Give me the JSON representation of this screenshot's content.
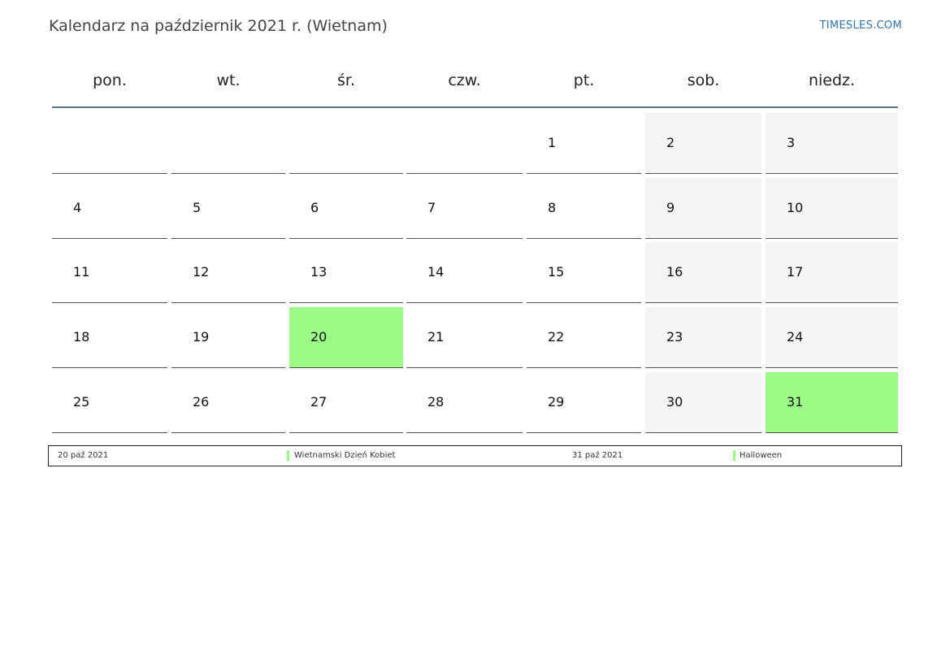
{
  "header": {
    "title": "Kalendarz na październik 2021 r. (Wietnam)",
    "brand": "TIMESLES.COM"
  },
  "weekdays": [
    "pon.",
    "wt.",
    "śr.",
    "czw.",
    "pt.",
    "sob.",
    "niedz."
  ],
  "weeks": [
    [
      "",
      "",
      "",
      "",
      "1",
      "2",
      "3"
    ],
    [
      "4",
      "5",
      "6",
      "7",
      "8",
      "9",
      "10"
    ],
    [
      "11",
      "12",
      "13",
      "14",
      "15",
      "16",
      "17"
    ],
    [
      "18",
      "19",
      "20",
      "21",
      "22",
      "23",
      "24"
    ],
    [
      "25",
      "26",
      "27",
      "28",
      "29",
      "30",
      "31"
    ]
  ],
  "holiday_days": [
    "20",
    "31"
  ],
  "legend": [
    {
      "date": "20 paź 2021",
      "name": "Wietnamski Dzień Kobiet"
    },
    {
      "date": "31 paź 2021",
      "name": "Halloween"
    }
  ],
  "colors": {
    "holiday": "#9afc86",
    "weekend": "#f4f4f4",
    "header_rule": "#5a7390",
    "brand": "#2e75b6"
  }
}
